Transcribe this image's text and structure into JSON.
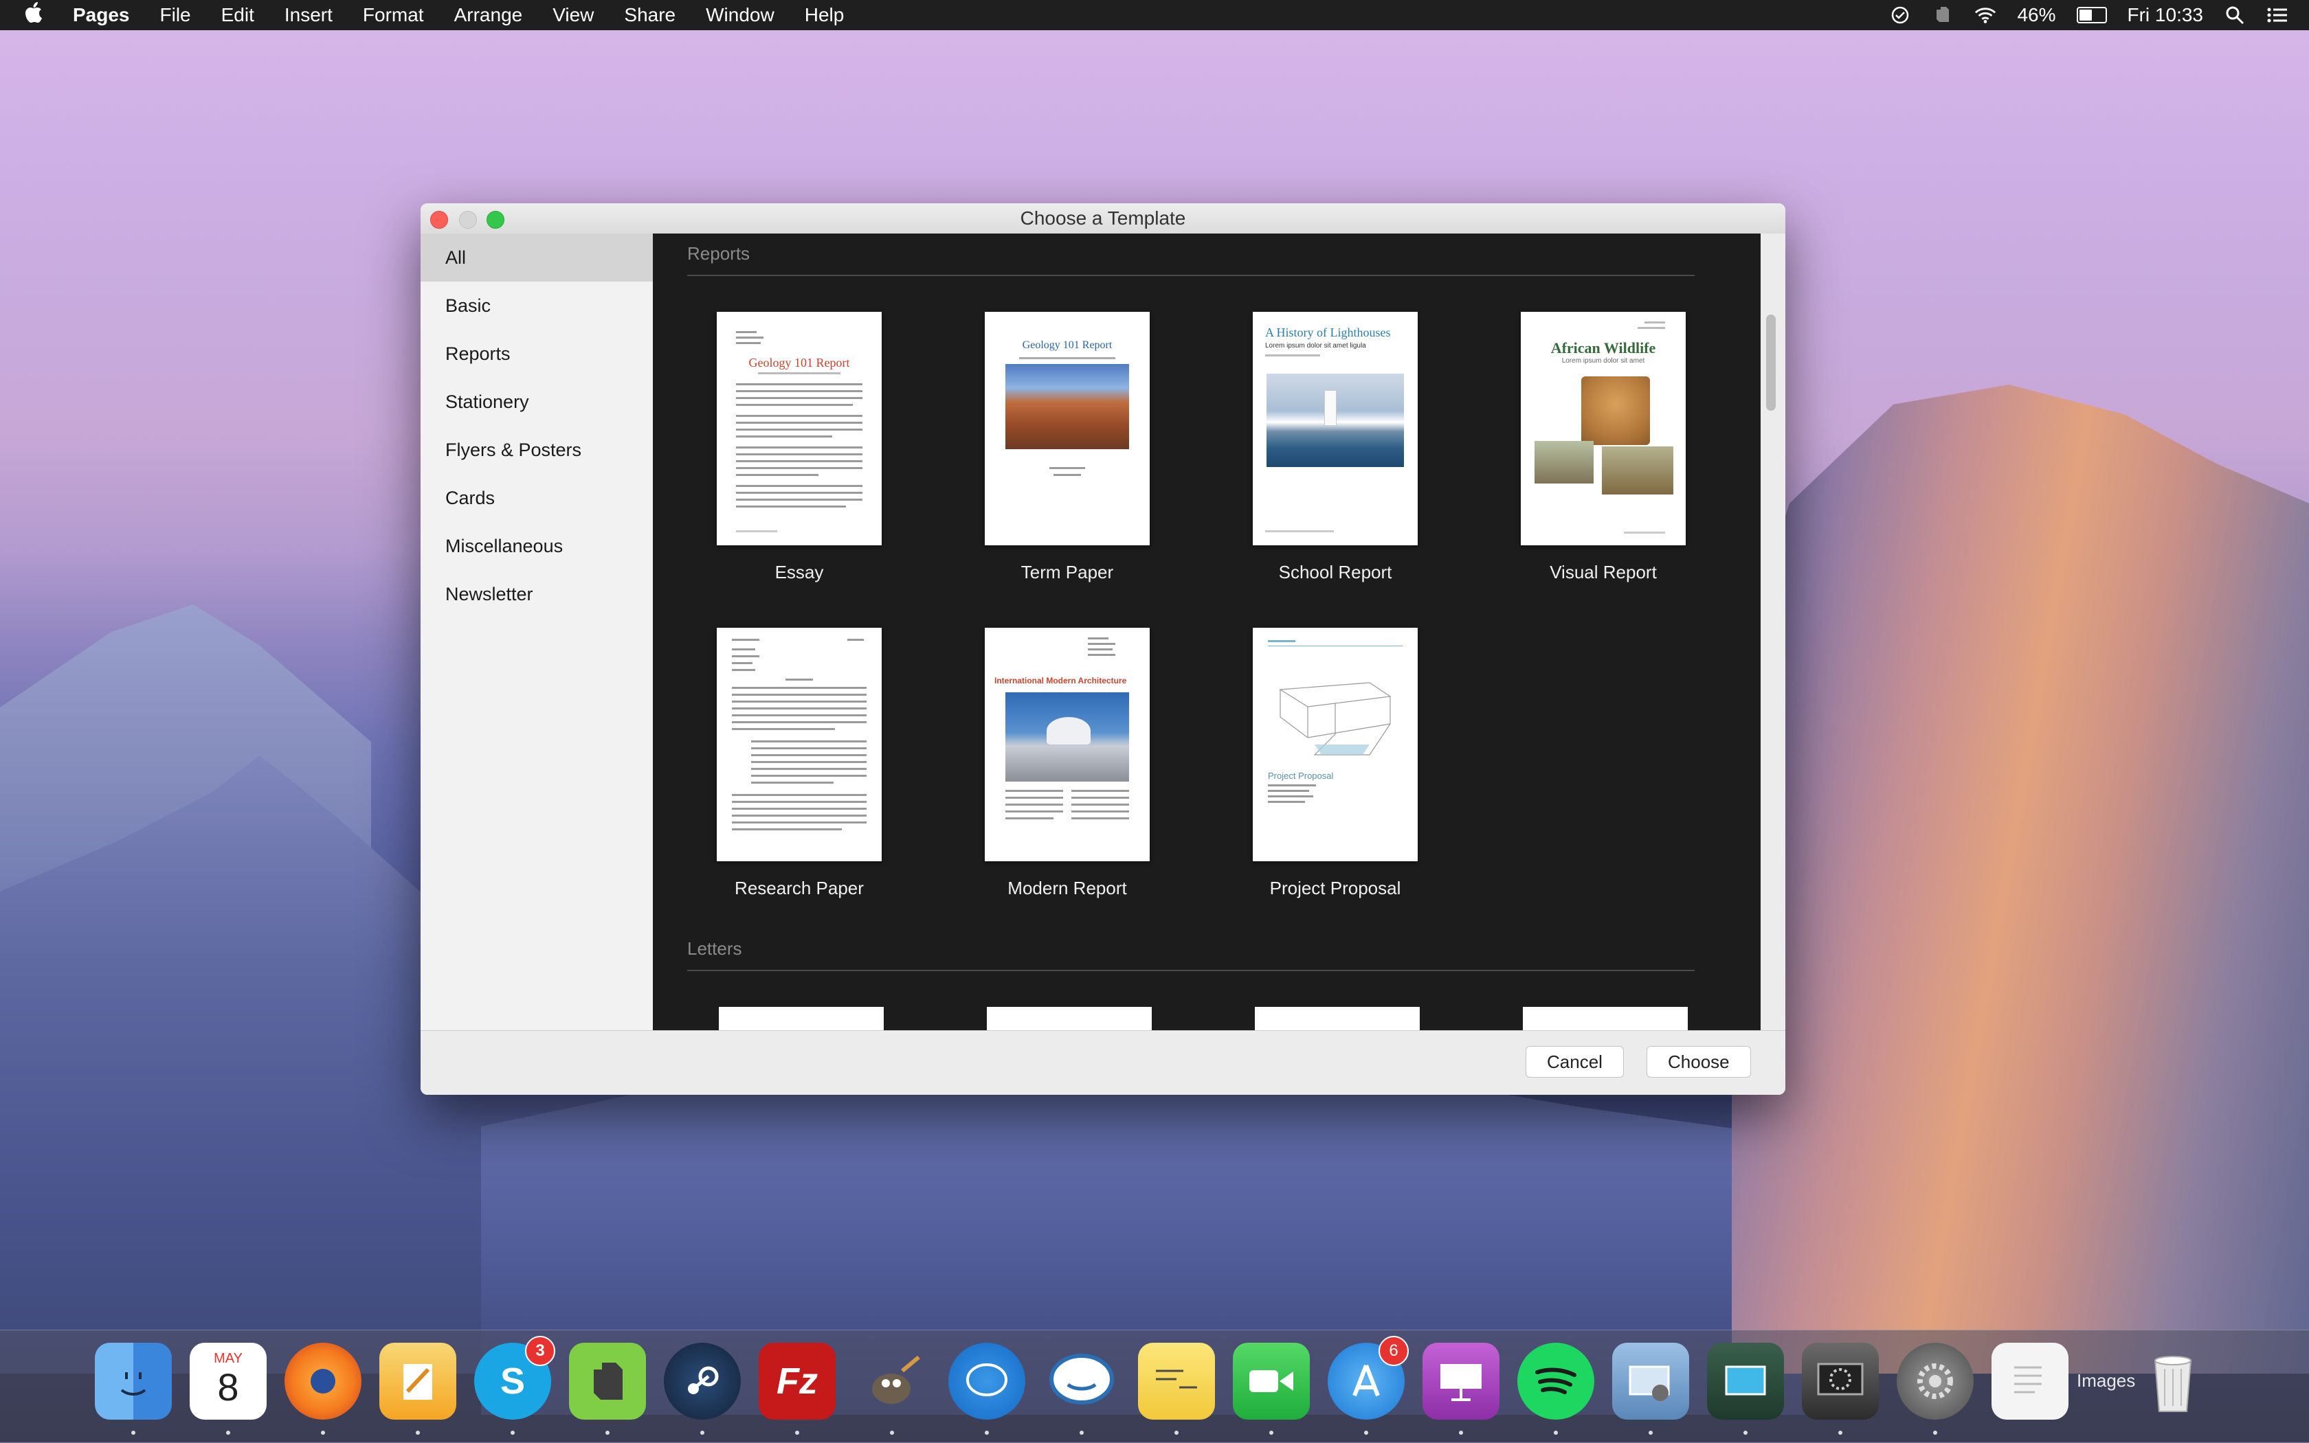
{
  "menubar": {
    "apple": "",
    "app_name": "Pages",
    "items": [
      "File",
      "Edit",
      "Insert",
      "Format",
      "Arrange",
      "View",
      "Share",
      "Window",
      "Help"
    ],
    "battery_percent": "46%",
    "battery_level": 0.46,
    "clock": "Fri 10:33"
  },
  "window": {
    "title": "Choose a Template",
    "sidebar": [
      "All",
      "Basic",
      "Reports",
      "Stationery",
      "Flyers & Posters",
      "Cards",
      "Miscellaneous",
      "Newsletter"
    ],
    "selected_category": "All",
    "sections": [
      {
        "title": "Reports",
        "templates": [
          "Essay",
          "Term Paper",
          "School Report",
          "Visual Report",
          "Research Paper",
          "Modern Report",
          "Project Proposal"
        ]
      },
      {
        "title": "Letters"
      }
    ],
    "thumb_text": {
      "essay_title": "Geology 101 Report",
      "term_title": "Geology 101 Report",
      "school_title": "A History of Lighthouses",
      "school_sub": "Lorem ipsum dolor sit amet ligula",
      "visual_title": "African Wildlife",
      "visual_sub": "Lorem ipsum dolor sit amet",
      "modern_title": "International Modern Architecture",
      "proposal_title": "Project Proposal"
    },
    "buttons": {
      "cancel": "Cancel",
      "choose": "Choose"
    }
  },
  "dock": {
    "calendar_month": "MAY",
    "calendar_day": "8",
    "skype_badge": "3",
    "appstore_badge": "6",
    "images_label": "Images"
  }
}
